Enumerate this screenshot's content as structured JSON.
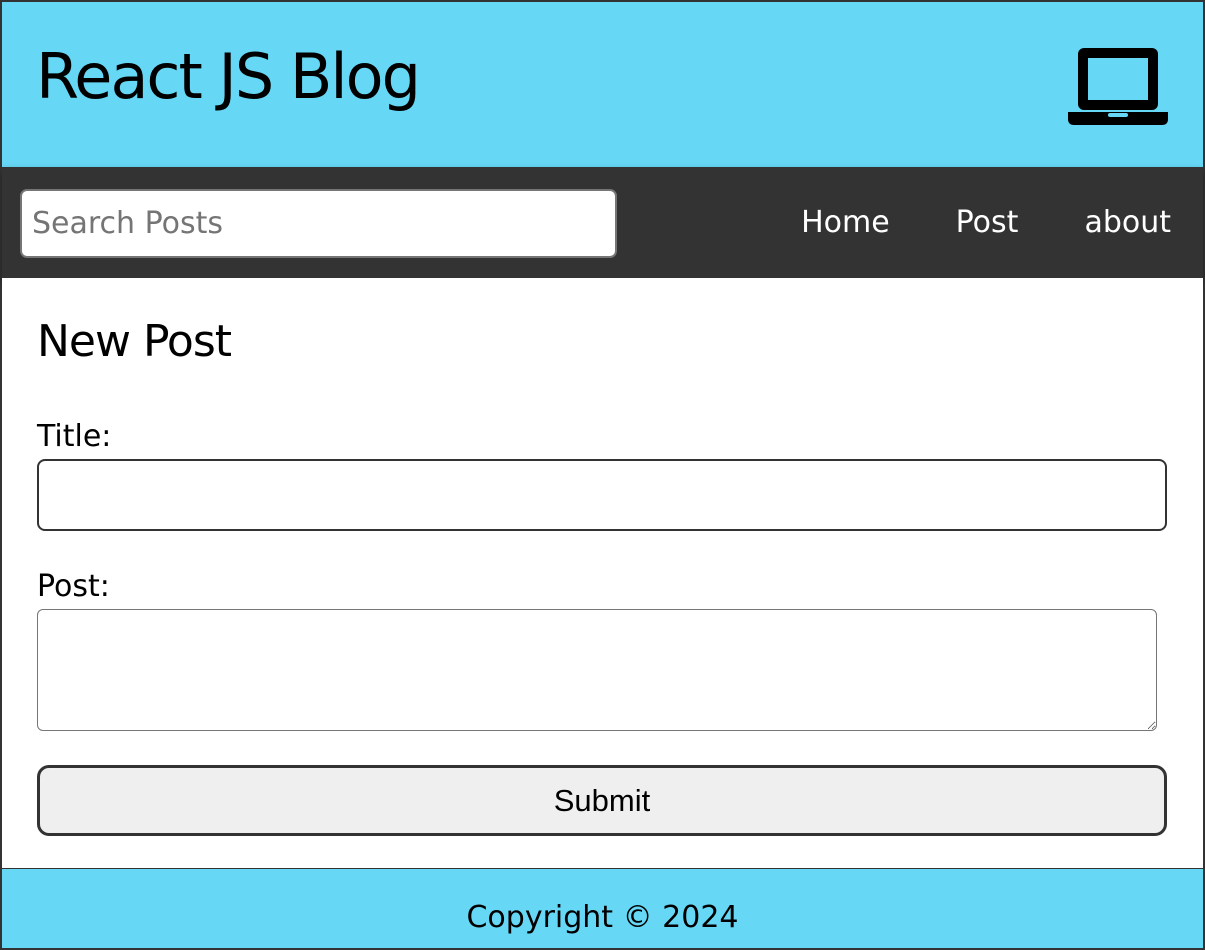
{
  "header": {
    "title": "React JS Blog",
    "icon": "laptop-icon"
  },
  "nav": {
    "search_placeholder": "Search Posts",
    "links": [
      {
        "label": "Home"
      },
      {
        "label": "Post"
      },
      {
        "label": "about"
      }
    ]
  },
  "main": {
    "page_title": "New Post",
    "title_label": "Title:",
    "title_value": "",
    "post_label": "Post:",
    "post_value": "",
    "submit_label": "Submit"
  },
  "footer": {
    "copyright": "Copyright © 2024"
  },
  "colors": {
    "header_bg": "#66d8f6",
    "nav_bg": "#333333",
    "footer_bg": "#66d8f6"
  }
}
